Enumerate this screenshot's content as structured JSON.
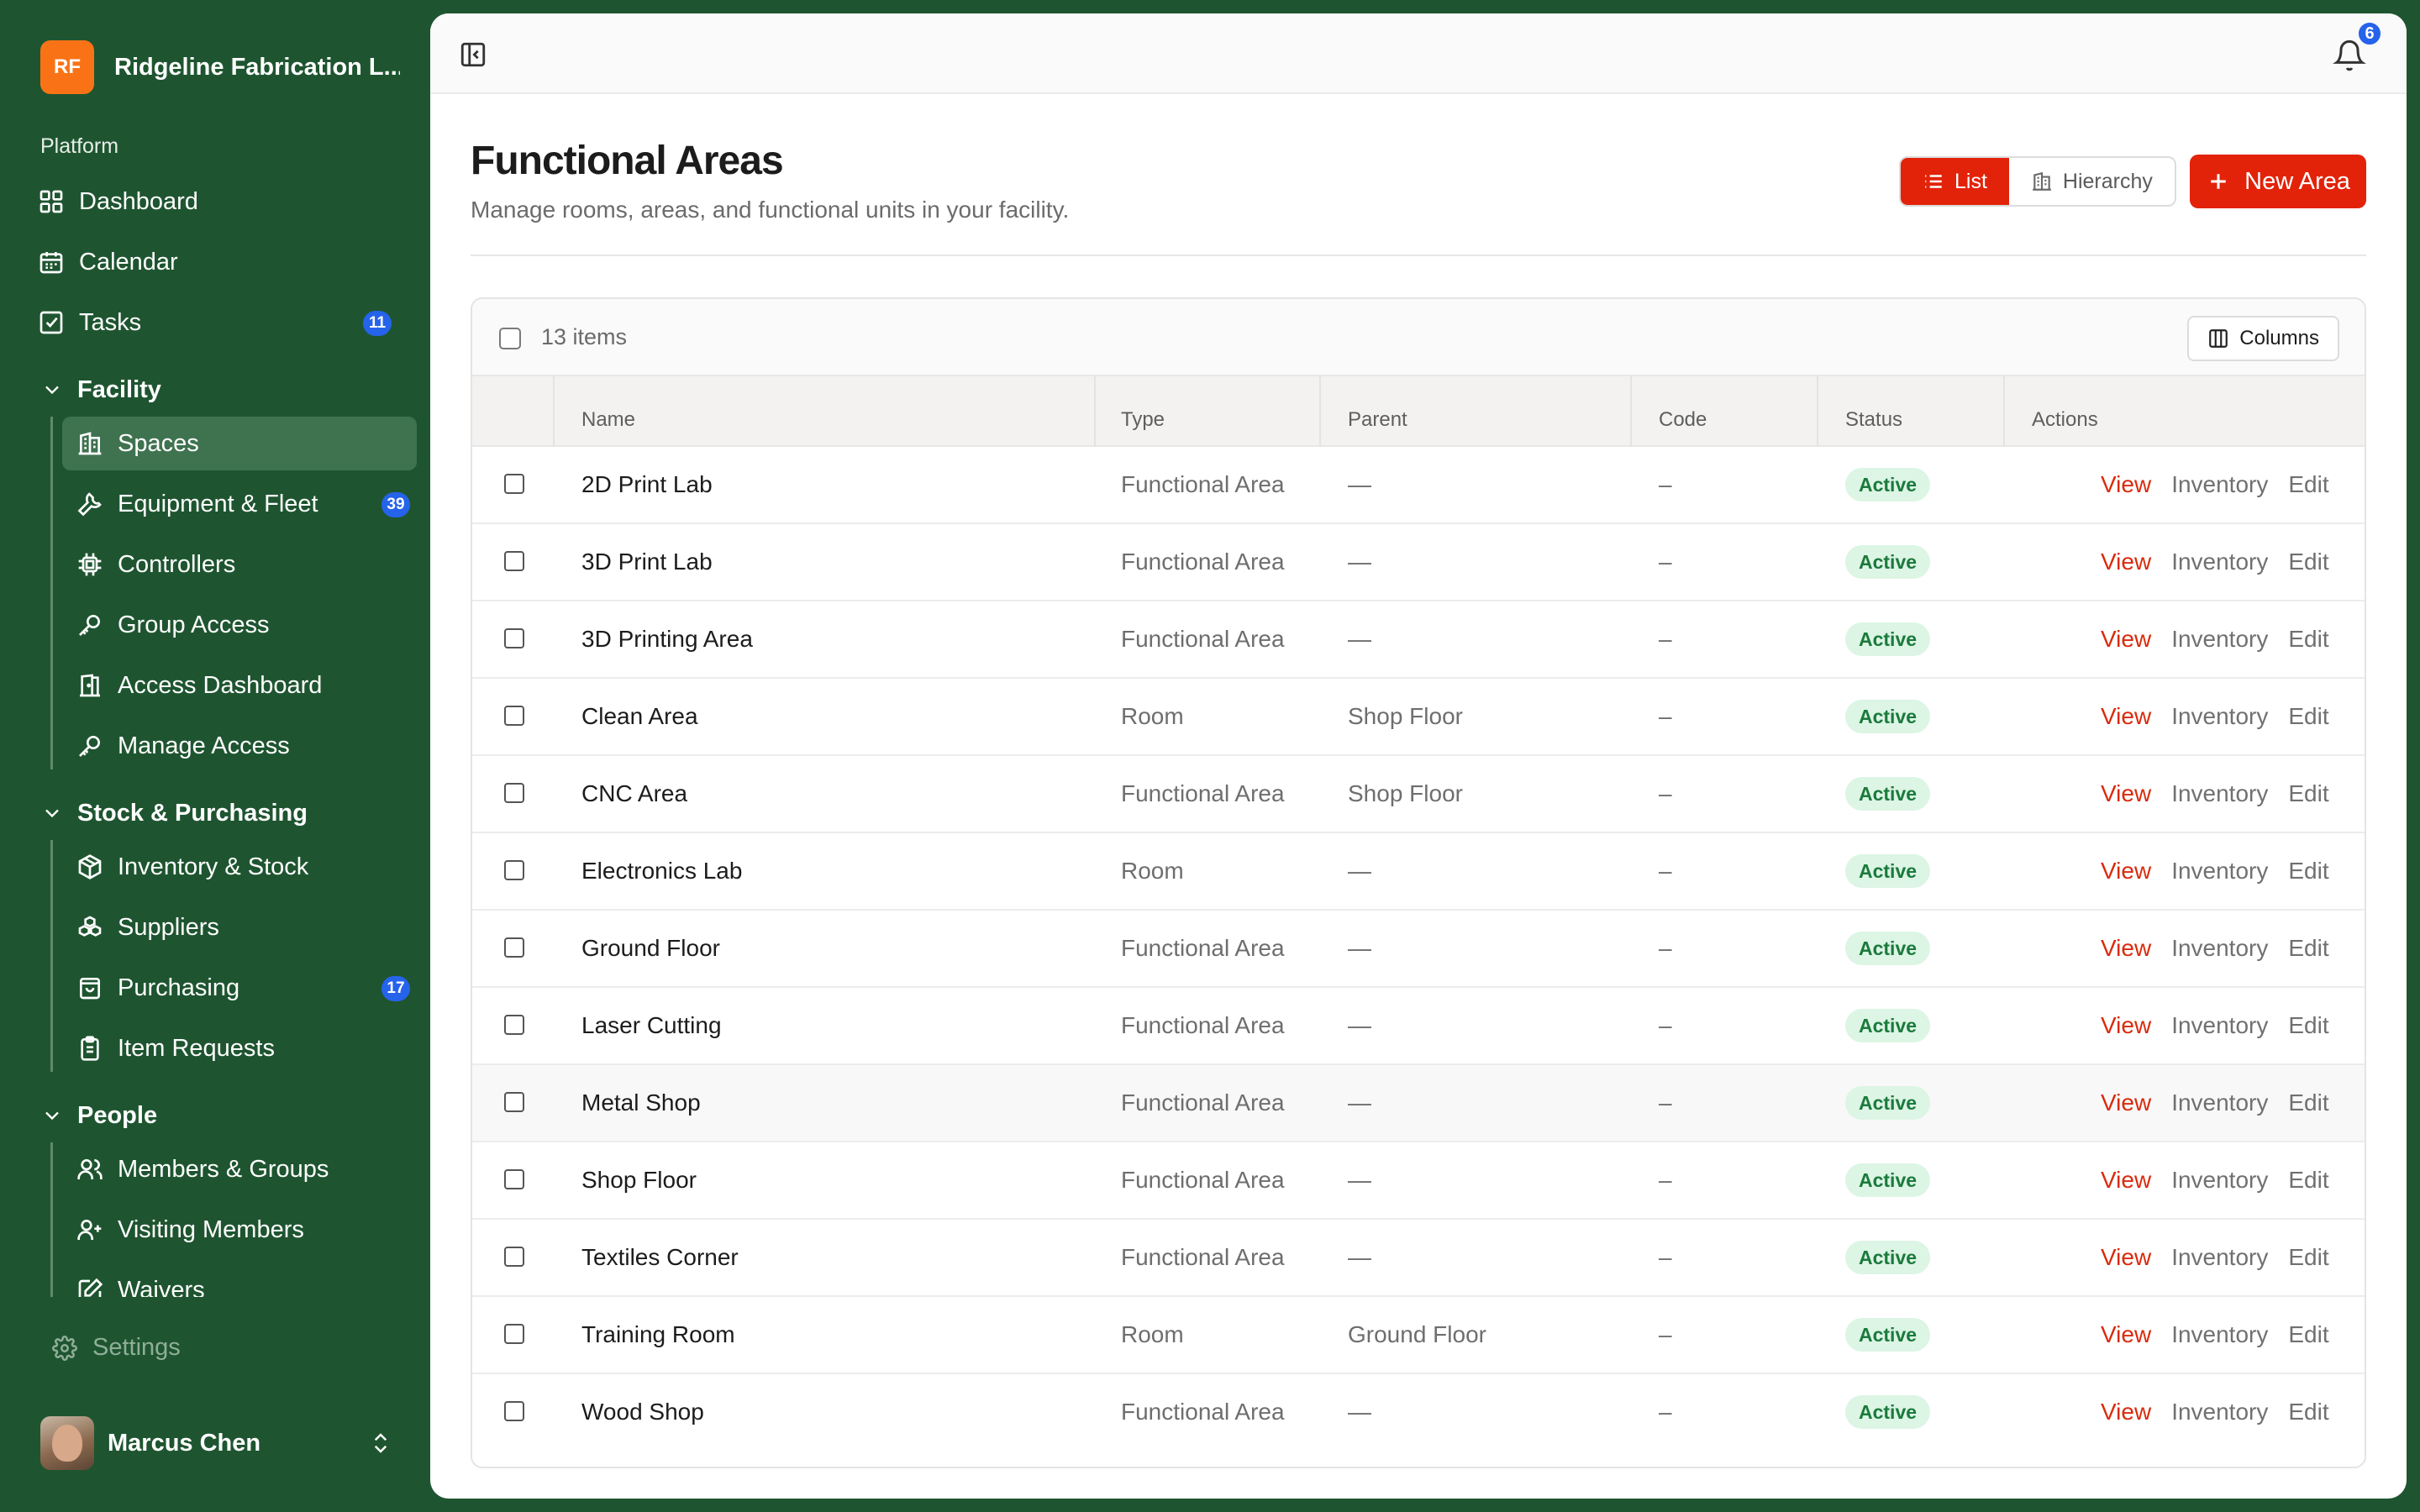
{
  "org": {
    "initials": "RF",
    "name": "Ridgeline Fabrication L..."
  },
  "sidebar": {
    "platform_label": "Platform",
    "top_items": [
      {
        "label": "Dashboard",
        "icon": "grid-icon"
      },
      {
        "label": "Calendar",
        "icon": "calendar-icon"
      },
      {
        "label": "Tasks",
        "icon": "checkbox-icon",
        "badge": "11"
      }
    ],
    "sections": [
      {
        "title": "Facility",
        "items": [
          {
            "label": "Spaces",
            "icon": "building-icon",
            "active": true
          },
          {
            "label": "Equipment & Fleet",
            "icon": "wrench-icon",
            "badge": "39"
          },
          {
            "label": "Controllers",
            "icon": "chip-icon"
          },
          {
            "label": "Group Access",
            "icon": "key-icon"
          },
          {
            "label": "Access Dashboard",
            "icon": "door-icon"
          },
          {
            "label": "Manage Access",
            "icon": "key-icon"
          }
        ]
      },
      {
        "title": "Stock & Purchasing",
        "items": [
          {
            "label": "Inventory & Stock",
            "icon": "box-icon"
          },
          {
            "label": "Suppliers",
            "icon": "boxes-icon"
          },
          {
            "label": "Purchasing",
            "icon": "bag-icon",
            "badge": "17"
          },
          {
            "label": "Item Requests",
            "icon": "clipboard-icon"
          }
        ]
      },
      {
        "title": "People",
        "items": [
          {
            "label": "Members & Groups",
            "icon": "users-icon"
          },
          {
            "label": "Visiting Members",
            "icon": "user-plus-icon"
          },
          {
            "label": "Waivers",
            "icon": "pen-square-icon"
          }
        ]
      }
    ],
    "settings_label": "Settings"
  },
  "user": {
    "name": "Marcus Chen"
  },
  "topbar": {
    "notification_count": "6"
  },
  "page": {
    "title": "Functional Areas",
    "subtitle": "Manage rooms, areas, and functional units in your facility.",
    "view_list": "List",
    "view_hierarchy": "Hierarchy",
    "new_button": "New Area"
  },
  "table": {
    "item_count": "13 items",
    "columns_button": "Columns",
    "headers": {
      "name": "Name",
      "type": "Type",
      "parent": "Parent",
      "code": "Code",
      "status": "Status",
      "actions": "Actions"
    },
    "actions": {
      "view": "View",
      "inventory": "Inventory",
      "edit": "Edit"
    },
    "rows": [
      {
        "name": "2D Print Lab",
        "type": "Functional Area",
        "parent": "—",
        "code": "–",
        "status": "Active"
      },
      {
        "name": "3D Print Lab",
        "type": "Functional Area",
        "parent": "—",
        "code": "–",
        "status": "Active"
      },
      {
        "name": "3D Printing Area",
        "type": "Functional Area",
        "parent": "—",
        "code": "–",
        "status": "Active"
      },
      {
        "name": "Clean Area",
        "type": "Room",
        "parent": "Shop Floor",
        "code": "–",
        "status": "Active"
      },
      {
        "name": "CNC Area",
        "type": "Functional Area",
        "parent": "Shop Floor",
        "code": "–",
        "status": "Active"
      },
      {
        "name": "Electronics Lab",
        "type": "Room",
        "parent": "—",
        "code": "–",
        "status": "Active"
      },
      {
        "name": "Ground Floor",
        "type": "Functional Area",
        "parent": "—",
        "code": "–",
        "status": "Active"
      },
      {
        "name": "Laser Cutting",
        "type": "Functional Area",
        "parent": "—",
        "code": "–",
        "status": "Active"
      },
      {
        "name": "Metal Shop",
        "type": "Functional Area",
        "parent": "—",
        "code": "–",
        "status": "Active"
      },
      {
        "name": "Shop Floor",
        "type": "Functional Area",
        "parent": "—",
        "code": "–",
        "status": "Active"
      },
      {
        "name": "Textiles Corner",
        "type": "Functional Area",
        "parent": "—",
        "code": "–",
        "status": "Active"
      },
      {
        "name": "Training Room",
        "type": "Room",
        "parent": "Ground Floor",
        "code": "–",
        "status": "Active"
      },
      {
        "name": "Wood Shop",
        "type": "Functional Area",
        "parent": "—",
        "code": "–",
        "status": "Active"
      }
    ]
  },
  "colors": {
    "sidebar_bg": "#1e5530",
    "accent": "#e2230a",
    "badge": "#2563eb",
    "status_bg": "#dcf5e4",
    "status_text": "#1a7a3c"
  }
}
